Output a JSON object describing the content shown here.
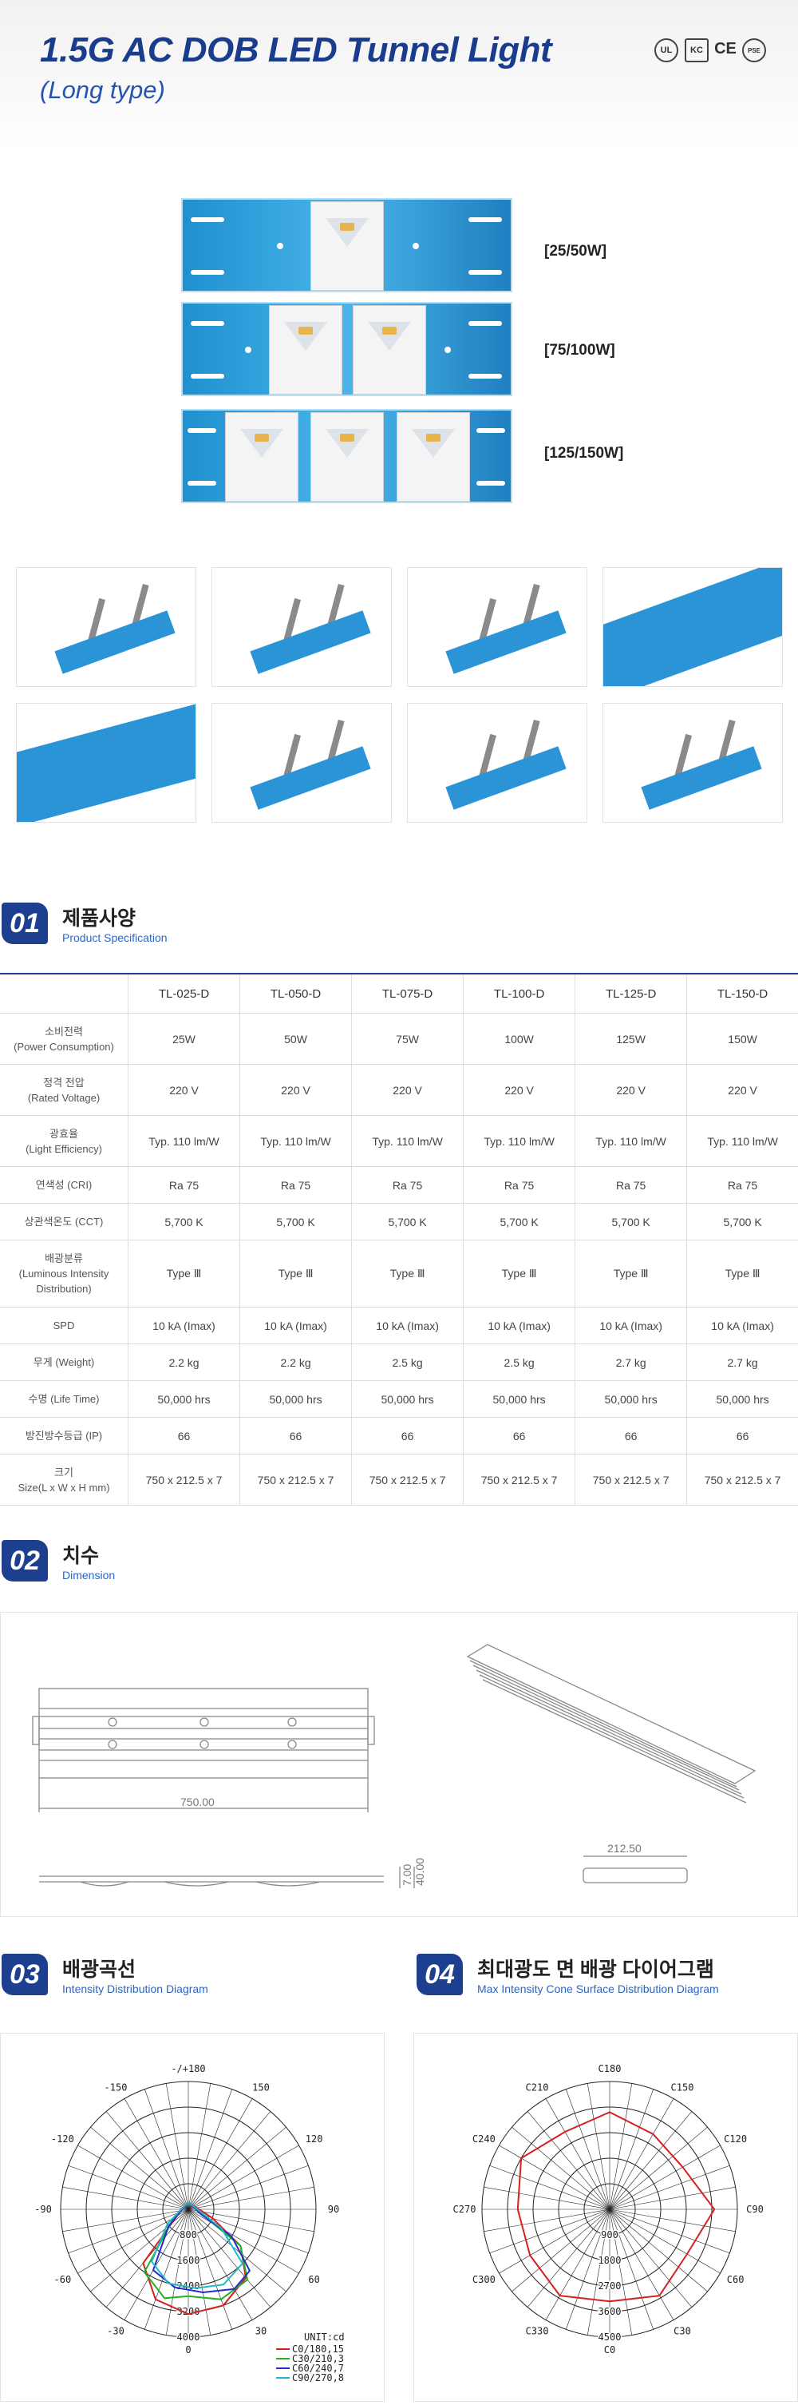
{
  "header": {
    "title": "1.5G AC DOB LED Tunnel Light",
    "subtitle": "(Long type)",
    "certs": [
      "UL",
      "KC",
      "CE",
      "PSE"
    ]
  },
  "variants": [
    {
      "label": "[25/50W]"
    },
    {
      "label": "[75/100W]"
    },
    {
      "label": "[125/150W]"
    }
  ],
  "sections": {
    "spec": {
      "num": "01",
      "ko": "제품사양",
      "en": "Product Specification"
    },
    "dimension": {
      "num": "02",
      "ko": "치수",
      "en": "Dimension"
    },
    "intensity": {
      "num": "03",
      "ko": "배광곡선",
      "en": "Intensity Distribution Diagram"
    },
    "cone": {
      "num": "04",
      "ko": "최대광도 면 배광 다이어그램",
      "en": "Max Intensity Cone Surface Distribution Diagram"
    }
  },
  "spec_table": {
    "models": [
      "TL-025-D",
      "TL-050-D",
      "TL-075-D",
      "TL-100-D",
      "TL-125-D",
      "TL-150-D"
    ],
    "rows": [
      {
        "label_ko": "소비전력",
        "label_en": "(Power Consumption)",
        "values": [
          "25W",
          "50W",
          "75W",
          "100W",
          "125W",
          "150W"
        ]
      },
      {
        "label_ko": "정격 전압",
        "label_en": "(Rated Voltage)",
        "values": [
          "220 V",
          "220 V",
          "220 V",
          "220 V",
          "220 V",
          "220 V"
        ]
      },
      {
        "label_ko": "광효율",
        "label_en": "(Light Efficiency)",
        "values": [
          "Typ. 110 lm/W",
          "Typ. 110 lm/W",
          "Typ. 110 lm/W",
          "Typ. 110 lm/W",
          "Typ. 110 lm/W",
          "Typ. 110 lm/W"
        ]
      },
      {
        "label_ko": "연색성 (CRI)",
        "label_en": "",
        "values": [
          "Ra 75",
          "Ra 75",
          "Ra 75",
          "Ra 75",
          "Ra 75",
          "Ra 75"
        ]
      },
      {
        "label_ko": "상관색온도 (CCT)",
        "label_en": "",
        "values": [
          "5,700 K",
          "5,700 K",
          "5,700 K",
          "5,700 K",
          "5,700 K",
          "5,700 K"
        ]
      },
      {
        "label_ko": "배광분류",
        "label_en": "(Luminous Intensity Distribution)",
        "values": [
          "Type Ⅲ",
          "Type Ⅲ",
          "Type Ⅲ",
          "Type Ⅲ",
          "Type Ⅲ",
          "Type Ⅲ"
        ]
      },
      {
        "label_ko": "SPD",
        "label_en": "",
        "values": [
          "10 kA (Imax)",
          "10 kA (Imax)",
          "10 kA (Imax)",
          "10 kA (Imax)",
          "10 kA (Imax)",
          "10 kA (Imax)"
        ]
      },
      {
        "label_ko": "무게 (Weight)",
        "label_en": "",
        "values": [
          "2.2 kg",
          "2.2 kg",
          "2.5 kg",
          "2.5 kg",
          "2.7 kg",
          "2.7 kg"
        ]
      },
      {
        "label_ko": "수명 (Life Time)",
        "label_en": "",
        "values": [
          "50,000 hrs",
          "50,000 hrs",
          "50,000 hrs",
          "50,000 hrs",
          "50,000 hrs",
          "50,000 hrs"
        ]
      },
      {
        "label_ko": "방진방수등급 (IP)",
        "label_en": "",
        "values": [
          "66",
          "66",
          "66",
          "66",
          "66",
          "66"
        ]
      },
      {
        "label_ko": "크기",
        "label_en": "Size(L x W x H mm)",
        "values": [
          "750 x 212.5 x 7",
          "750 x 212.5 x 7",
          "750 x 212.5 x 7",
          "750 x 212.5 x 7",
          "750 x 212.5 x 7",
          "750 x 212.5 x 7"
        ]
      }
    ]
  },
  "dimensions": {
    "length": "750.00",
    "width": "212.50",
    "h1": "7.00",
    "h2": "40.00"
  },
  "polar_left": {
    "angles": [
      "-/+180",
      "150",
      "120",
      "90",
      "60",
      "30",
      "0",
      "-30",
      "-60",
      "-90",
      "-120",
      "-150"
    ],
    "radii": [
      "800",
      "1600",
      "2400",
      "3200",
      "4000"
    ],
    "unit": "UNIT:cd",
    "legend": [
      {
        "name": "C0/180,15",
        "color": "#d42020"
      },
      {
        "name": "C30/210,3",
        "color": "#22b022"
      },
      {
        "name": "C60/240,7",
        "color": "#2030c8"
      },
      {
        "name": "C90/270,8",
        "color": "#22b8c8"
      }
    ]
  },
  "polar_right": {
    "angles": [
      "C180",
      "C150",
      "C120",
      "C90",
      "C60",
      "C30",
      "C0",
      "C330",
      "C300",
      "C270",
      "C240",
      "C210"
    ],
    "radii": [
      "900",
      "1800",
      "2700",
      "3600",
      "4500"
    ],
    "curve_color": "#d42020"
  }
}
